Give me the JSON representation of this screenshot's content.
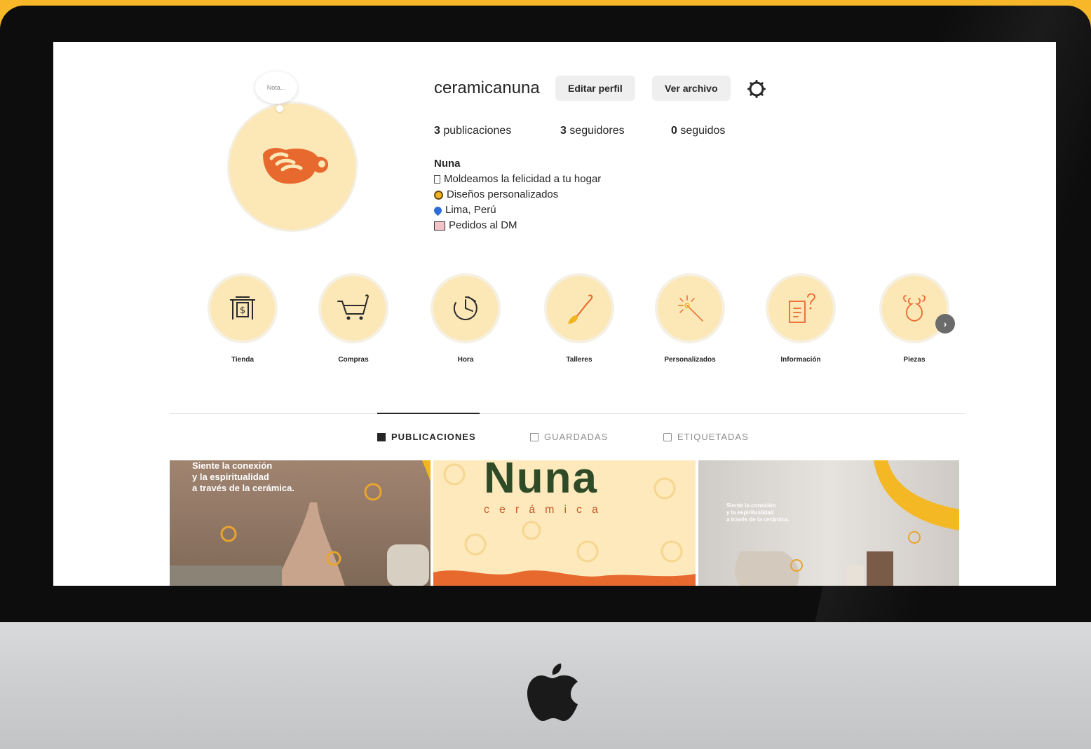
{
  "profile": {
    "username": "ceramicanuna",
    "note_label": "Nota...",
    "edit_button": "Editar perfil",
    "archive_button": "Ver archivo",
    "stats": {
      "posts": "3",
      "posts_label": "publicaciones",
      "followers": "3",
      "followers_label": "seguidores",
      "following": "0",
      "following_label": "seguidos"
    },
    "bio": {
      "name": "Nuna",
      "lines": [
        "Moldeamos la felicidad a tu hogar",
        "Diseños personalizados",
        "Lima, Perú",
        "Pedidos al DM"
      ]
    }
  },
  "highlights": [
    {
      "label": "Tienda",
      "icon": "store-icon"
    },
    {
      "label": "Compras",
      "icon": "cart-icon"
    },
    {
      "label": "Hora",
      "icon": "clock-icon"
    },
    {
      "label": "Talleres",
      "icon": "brush-icon"
    },
    {
      "label": "Personalizados",
      "icon": "magic-wand-icon"
    },
    {
      "label": "Información",
      "icon": "document-question-icon"
    },
    {
      "label": "Piezas",
      "icon": "vase-icon"
    }
  ],
  "tabs": {
    "posts": "PUBLICACIONES",
    "saved": "GUARDADAS",
    "tagged": "ETIQUETADAS"
  },
  "posts": [
    {
      "text_lines": [
        "Siente la conexión",
        "y la espiritualidad",
        "a través de la cerámica."
      ]
    },
    {
      "brand": "Nuna",
      "subtitle": "cerámica"
    },
    {
      "text_lines": [
        "Siente la conexión",
        "y la espiritualidad",
        "a través de la cerámica."
      ]
    }
  ],
  "colors": {
    "background": "#f7b728",
    "highlight_fill": "#fce7b6",
    "accent": "#e8692e"
  }
}
